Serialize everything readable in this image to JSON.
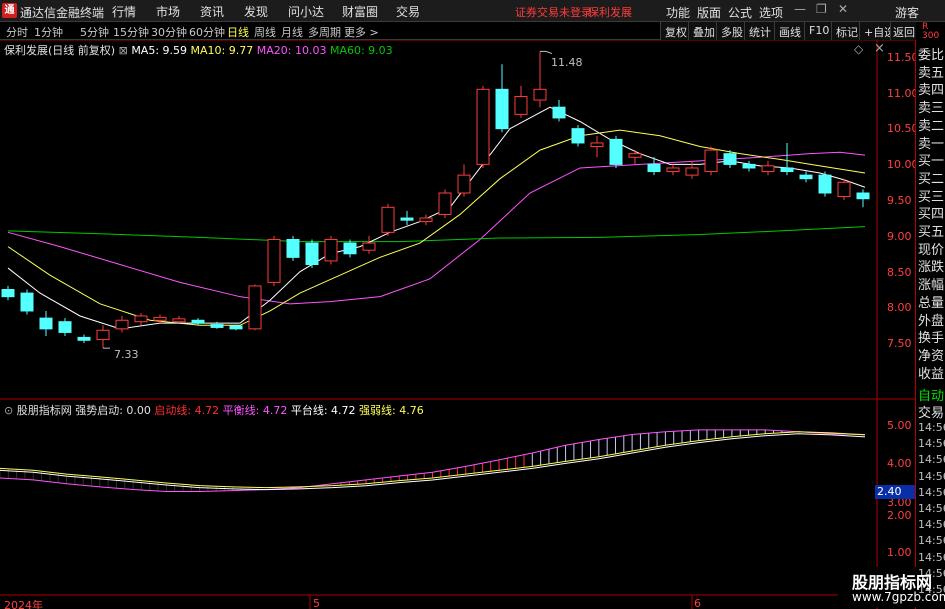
{
  "app": {
    "logo_text": "通",
    "title": "通达信金融终端",
    "menus": [
      "行情",
      "市场",
      "资讯",
      "发现",
      "问小达",
      "财富圈",
      "交易"
    ],
    "login_warning": "证券交易未登录",
    "stock_name": "保利发展",
    "right_menus": [
      "功能",
      "版面",
      "公式",
      "选项"
    ],
    "guest_label": "游客"
  },
  "period_tabs": [
    "分时",
    "1分钟",
    "5分钟",
    "15分钟",
    "30分钟",
    "60分钟",
    "日线",
    "周线",
    "月线",
    "多周期",
    "更多 >"
  ],
  "active_period": "日线",
  "toolbar": [
    "复权",
    "叠加",
    "多股",
    "统计",
    "画线",
    "F10",
    "标记",
    "+自选",
    "返回"
  ],
  "corner_label": {
    "line1": "R",
    "line2": "300"
  },
  "main_info": {
    "title": "保利发展(日线 前复权)",
    "ma5": "MA5: 9.59",
    "ma10": "MA10: 9.77",
    "ma20": "MA20: 10.03",
    "ma60": "MA60: 9.03",
    "high_label": "11.48",
    "low_label": "7.33",
    "colors": {
      "ma5": "#ffffff",
      "ma10": "#ffff54",
      "ma20": "#ff54ff",
      "ma60": "#00c800"
    }
  },
  "price_axis": [
    "11.50",
    "11.00",
    "10.50",
    "10.00",
    "9.50",
    "9.00",
    "8.50",
    "8.00",
    "7.50"
  ],
  "indicator_info": {
    "title": "股朋指标网",
    "strong_start": "强势启动: 0.00",
    "start_line": "启动线: 4.72",
    "balance_line": "平衡线: 4.72",
    "platform_line": "平台线: 4.72",
    "weak_line": "强弱线: 4.76",
    "colors": {
      "start": "#ff3030",
      "balance": "#ff54ff",
      "platform": "#ffffff",
      "weak": "#ffff54"
    }
  },
  "indicator_axis": [
    "5.00",
    "4.00",
    "3.00",
    "2.00",
    "1.00"
  ],
  "side_panel": {
    "labels": [
      "委比",
      "卖五",
      "卖四",
      "卖三",
      "卖二",
      "卖一",
      "买一",
      "买二",
      "买三",
      "买四",
      "买五",
      "现价",
      "涨跌",
      "涨幅",
      "总量",
      "外盘",
      "换手",
      "净资",
      "收益"
    ],
    "extra": [
      "自动",
      "交易"
    ],
    "times": [
      "14:56",
      "14:56",
      "14:56",
      "14:56",
      "14:56",
      "14:56",
      "14:56",
      "14:56",
      "14:56",
      "14:56",
      "14:56"
    ]
  },
  "price_badge": "2.40",
  "dates": [
    "2024年",
    "5",
    "6"
  ],
  "watermark": {
    "cn": "股朋指标网",
    "url": "www.7gpzb.com"
  }
}
